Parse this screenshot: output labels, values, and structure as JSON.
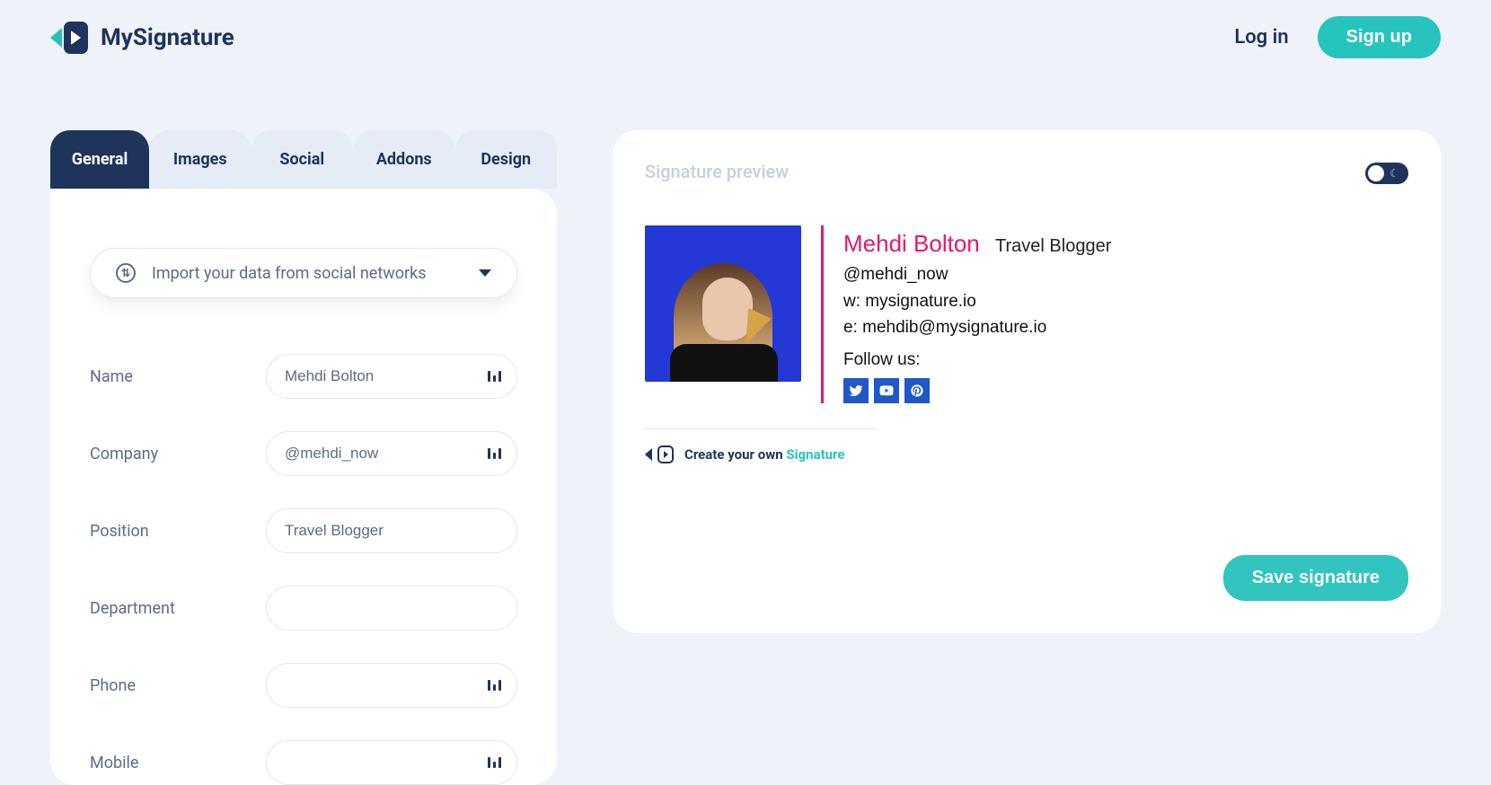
{
  "brand": {
    "name": "MySignature"
  },
  "header": {
    "login": "Log in",
    "signup": "Sign up"
  },
  "tabs": {
    "general": "General",
    "images": "Images",
    "social": "Social",
    "addons": "Addons",
    "design": "Design"
  },
  "import": {
    "label": "Import your data from social networks"
  },
  "form": {
    "labels": {
      "name": "Name",
      "company": "Company",
      "position": "Position",
      "department": "Department",
      "phone": "Phone",
      "mobile": "Mobile"
    },
    "values": {
      "name": "Mehdi Bolton",
      "company": "@mehdi_now",
      "position": "Travel Blogger",
      "department": "",
      "phone": "",
      "mobile": ""
    }
  },
  "preview": {
    "title": "Signature preview",
    "name": "Mehdi Bolton",
    "position": "Travel Blogger",
    "handle": "@mehdi_now",
    "website_prefix": "w: ",
    "website": "mysignature.io",
    "email_prefix": "e: ",
    "email": "mehdib@mysignature.io",
    "follow": "Follow us:",
    "social_icons": [
      "twitter",
      "youtube",
      "pinterest"
    ]
  },
  "footer": {
    "create_prefix": "Create your own ",
    "create_accent": "Signature"
  },
  "actions": {
    "save": "Save signature"
  },
  "colors": {
    "accent": "#27c4be",
    "brand_dark": "#1f345a",
    "pink": "#e7166e",
    "social_blue": "#1f58c7"
  }
}
